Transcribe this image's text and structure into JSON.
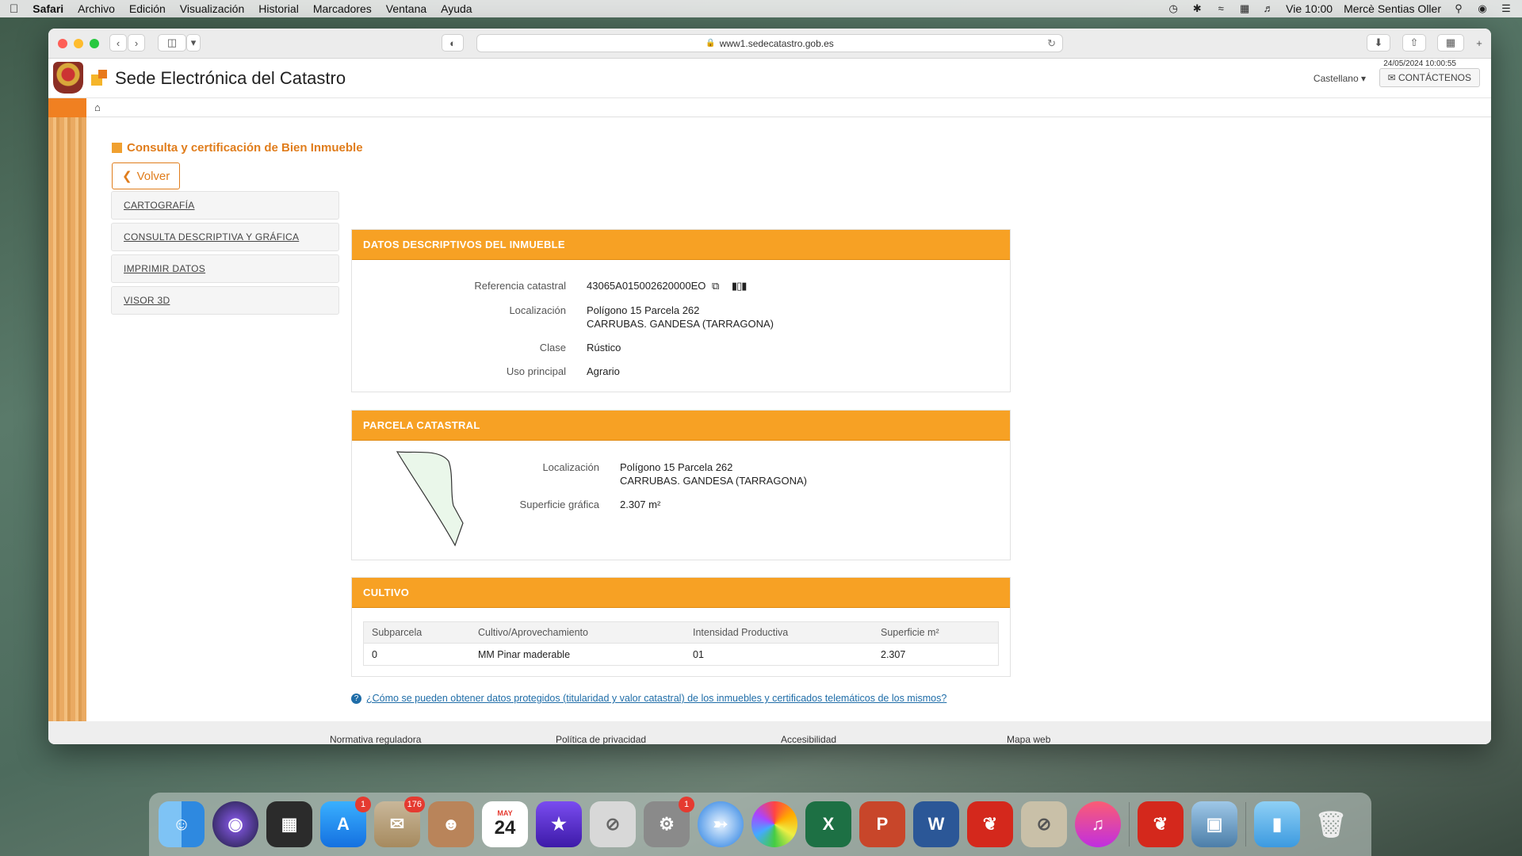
{
  "menubar": {
    "app": "Safari",
    "items": [
      "Archivo",
      "Edición",
      "Visualización",
      "Historial",
      "Marcadores",
      "Ventana",
      "Ayuda"
    ],
    "clock": "Vie 10:00",
    "user": "Mercè Sentias Oller"
  },
  "browser": {
    "url": "www1.sedecatastro.gob.es"
  },
  "site": {
    "title": "Sede Electrónica del Catastro",
    "datetime": "24/05/2024  10:00:55",
    "language": "Castellano",
    "contact_label": "CONTÁCTENOS"
  },
  "page": {
    "heading": "Consulta y certificación de Bien Inmueble",
    "back_label": "Volver",
    "side_menu": [
      "CARTOGRAFÍA",
      "CONSULTA DESCRIPTIVA Y GRÁFICA",
      "IMPRIMIR DATOS",
      "VISOR 3D"
    ]
  },
  "datos": {
    "title": "DATOS DESCRIPTIVOS DEL INMUEBLE",
    "ref_label": "Referencia catastral",
    "ref_value": "43065A015002620000EO",
    "loc_label": "Localización",
    "loc_line1": "Polígono 15 Parcela 262",
    "loc_line2": "CARRUBAS. GANDESA (TARRAGONA)",
    "clase_label": "Clase",
    "clase_value": "Rústico",
    "uso_label": "Uso principal",
    "uso_value": "Agrario"
  },
  "parcela": {
    "title": "PARCELA CATASTRAL",
    "loc_label": "Localización",
    "loc_line1": "Polígono 15 Parcela 262",
    "loc_line2": "CARRUBAS. GANDESA (TARRAGONA)",
    "sup_label": "Superficie gráfica",
    "sup_value": "2.307 m²"
  },
  "cultivo": {
    "title": "CULTIVO",
    "headers": [
      "Subparcela",
      "Cultivo/Aprovechamiento",
      "Intensidad Productiva",
      "Superficie m²"
    ],
    "rows": [
      [
        "0",
        "MM Pinar maderable",
        "01",
        "2.307"
      ]
    ]
  },
  "help_link": "¿Cómo se pueden obtener datos protegidos (titularidad y valor catastral) de los inmuebles y certificados telemáticos de los mismos?",
  "footer": [
    "Normativa reguladora",
    "Política de privacidad",
    "Accesibilidad",
    "Mapa web"
  ],
  "dock": {
    "calendar_month": "MAY",
    "calendar_day": "24",
    "appstore_badge": "1",
    "mail_badge": "176",
    "settings_badge": "1"
  }
}
